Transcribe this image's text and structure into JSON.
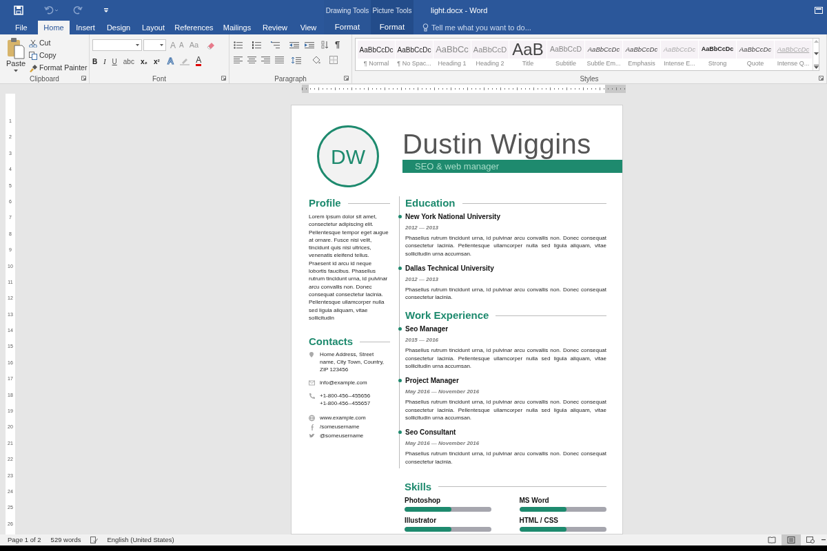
{
  "window": {
    "title": "light.docx - Word"
  },
  "tabs": [
    {
      "label": "File",
      "selected": false
    },
    {
      "label": "Home",
      "selected": true
    },
    {
      "label": "Insert",
      "selected": false
    },
    {
      "label": "Design",
      "selected": false
    },
    {
      "label": "Layout",
      "selected": false
    },
    {
      "label": "References",
      "selected": false
    },
    {
      "label": "Mailings",
      "selected": false
    },
    {
      "label": "Review",
      "selected": false
    },
    {
      "label": "View",
      "selected": false
    }
  ],
  "contextual_tabs": [
    {
      "group": "Drawing Tools",
      "label": "Format",
      "selected": false
    },
    {
      "group": "Picture Tools",
      "label": "Format",
      "selected": false
    }
  ],
  "tell_me": {
    "placeholder": "Tell me what you want to do..."
  },
  "clipboard": {
    "paste": "Paste",
    "commands": [
      "Cut",
      "Copy",
      "Format Painter"
    ],
    "label": "Clipboard"
  },
  "font": {
    "grow": "A",
    "shrink": "A",
    "change_case": "Aa",
    "format_buttons": [
      "B",
      "I",
      "U",
      "abc",
      "x₂",
      "x²"
    ],
    "text_effects": "A",
    "font_color": "A",
    "label": "Font"
  },
  "paragraph": {
    "show_marks": "¶",
    "label": "Paragraph"
  },
  "styles": {
    "label": "Styles",
    "items": [
      {
        "preview": "AaBbCcDc",
        "name": "¶ Normal",
        "kind": "normal"
      },
      {
        "preview": "AaBbCcDc",
        "name": "¶ No Spac...",
        "kind": "normal"
      },
      {
        "preview": "AaBbCc",
        "name": "Heading 1",
        "kind": "heading1"
      },
      {
        "preview": "AaBbCcD",
        "name": "Heading 2",
        "kind": "heading2"
      },
      {
        "preview": "AaB",
        "name": "Title",
        "kind": "title"
      },
      {
        "preview": "AaBbCcD",
        "name": "Subtitle",
        "kind": "subtitle"
      },
      {
        "preview": "AaBbCcDc",
        "name": "Subtle Em...",
        "kind": "italic"
      },
      {
        "preview": "AaBbCcDc",
        "name": "Emphasis",
        "kind": "italic"
      },
      {
        "preview": "AaBbCcDc",
        "name": "Intense E...",
        "kind": "faint-italic"
      },
      {
        "preview": "AaBbCcDc",
        "name": "Strong",
        "kind": "strong"
      },
      {
        "preview": "AaBbCcDc",
        "name": "Quote",
        "kind": "italic"
      },
      {
        "preview": "AaBbCcDc",
        "name": "Intense Q...",
        "kind": "intense-quote"
      }
    ]
  },
  "vertical_ruler": [
    "1",
    "2",
    "3",
    "4",
    "5",
    "6",
    "7",
    "8",
    "9",
    "10",
    "11",
    "12",
    "13",
    "14",
    "15",
    "16",
    "17",
    "18",
    "19",
    "20",
    "21",
    "22",
    "23",
    "24",
    "25",
    "26"
  ],
  "resume": {
    "initials": "DW",
    "name": "Dustin Wiggins",
    "role": "SEO & web manager",
    "profile": {
      "heading": "Profile",
      "text": "Lorem ipsum dolor sit amet, consectetur adipiscing elit. Pellentesque tempor eget augue at ornare. Fusce nisi velit, tincidunt quis nisi ultrices, venenatis eleifend tellus. Praesent id arcu id neque lobortis faucibus. Phasellus rutrum tincidunt urna, id pulvinar arcu convallis non. Donec consequat consectetur lacinia. Pellentesque ullamcorper nulla sed ligula aliquam, vitae sollicitudin"
    },
    "contacts": {
      "heading": "Contacts",
      "items": [
        {
          "kind": "address",
          "lines": [
            "Home Address, Street name, City Town, Country, ZIP 123456"
          ]
        },
        {
          "kind": "email",
          "lines": [
            "info@example.com"
          ]
        },
        {
          "kind": "phone",
          "lines": [
            "+1-800-456--455656",
            "+1-800-456--455657"
          ]
        },
        {
          "kind": "web",
          "lines": [
            "www.example.com"
          ]
        },
        {
          "kind": "facebook",
          "lines": [
            "/someusername"
          ]
        },
        {
          "kind": "twitter",
          "lines": [
            "@someusername"
          ]
        }
      ]
    },
    "sections": [
      {
        "heading": "Education",
        "entries": [
          {
            "title": "New York National University",
            "dates": "2012 — 2013",
            "text": "Phasellus rutrum tincidunt urna, id pulvinar arcu convallis non. Donec consequat consectetur lacinia. Pellentesque ullamcorper nulla sed ligula aliquam, vitae sollicitudin urna accumsan."
          },
          {
            "title": "Dallas Technical University",
            "dates": "2012 — 2013",
            "text": "Phasellus rutrum tincidunt urna, id pulvinar arcu convallis non. Donec consequat consectetur lacinia."
          }
        ]
      },
      {
        "heading": "Work Experience",
        "entries": [
          {
            "title": "Seo Manager",
            "dates": "2015 — 2016",
            "text": "Phasellus rutrum tincidunt urna, id pulvinar arcu convallis non. Donec consequat consectetur lacinia. Pellentesque ullamcorper nulla sed ligula aliquam, vitae sollicitudin urna accumsan."
          },
          {
            "title": "Project Manager",
            "dates": "May 2016 — November 2016",
            "text": "Phasellus rutrum tincidunt urna, id pulvinar arcu convallis non. Donec consequat consectetur lacinia. Pellentesque ullamcorper nulla sed ligula aliquam, vitae sollicitudin urna accumsan."
          },
          {
            "title": "Seo Consultant",
            "dates": "May 2016 — November 2016",
            "text": "Phasellus rutrum tincidunt urna, id pulvinar arcu convallis non. Donec consequat consectetur lacinia."
          }
        ]
      }
    ],
    "skills": {
      "heading": "Skills",
      "items": [
        {
          "name": "Photoshop",
          "level": 0.54
        },
        {
          "name": "MS Word",
          "level": 0.54
        },
        {
          "name": "Illustrator",
          "level": 0.54
        },
        {
          "name": "HTML / CSS",
          "level": 0.54
        }
      ]
    }
  },
  "status_bar": {
    "page": "Page 1 of 2",
    "words": "529 words",
    "language": "English (United States)"
  }
}
